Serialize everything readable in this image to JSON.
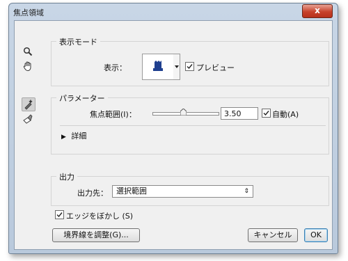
{
  "dialog": {
    "title": "焦点領域",
    "close_label": "x"
  },
  "tools": [
    {
      "name": "zoom-tool-icon"
    },
    {
      "name": "hand-tool-icon"
    },
    {
      "name": "add-to-focus-brush-icon"
    },
    {
      "name": "subtract-from-focus-brush-icon"
    }
  ],
  "view_mode": {
    "legend": "表示モード",
    "view_label": "表示：",
    "preview_label": "プレビュー",
    "preview_checked": true
  },
  "parameters": {
    "legend": "パラメーター",
    "focus_range_label": "焦点範囲(I)：",
    "focus_range_value": "3.50",
    "slider_fraction": 0.47,
    "auto_label": "自動(A)",
    "auto_checked": true,
    "advanced_label": "詳細"
  },
  "output": {
    "legend": "出力",
    "output_to_label": "出力先：",
    "output_to_value": "選択範囲"
  },
  "soften_edge": {
    "label": "エッジをぼかし (S)",
    "checked": true
  },
  "buttons": {
    "refine_edge": "境界線を調整(G)...",
    "cancel": "キャンセル",
    "ok": "OK"
  }
}
